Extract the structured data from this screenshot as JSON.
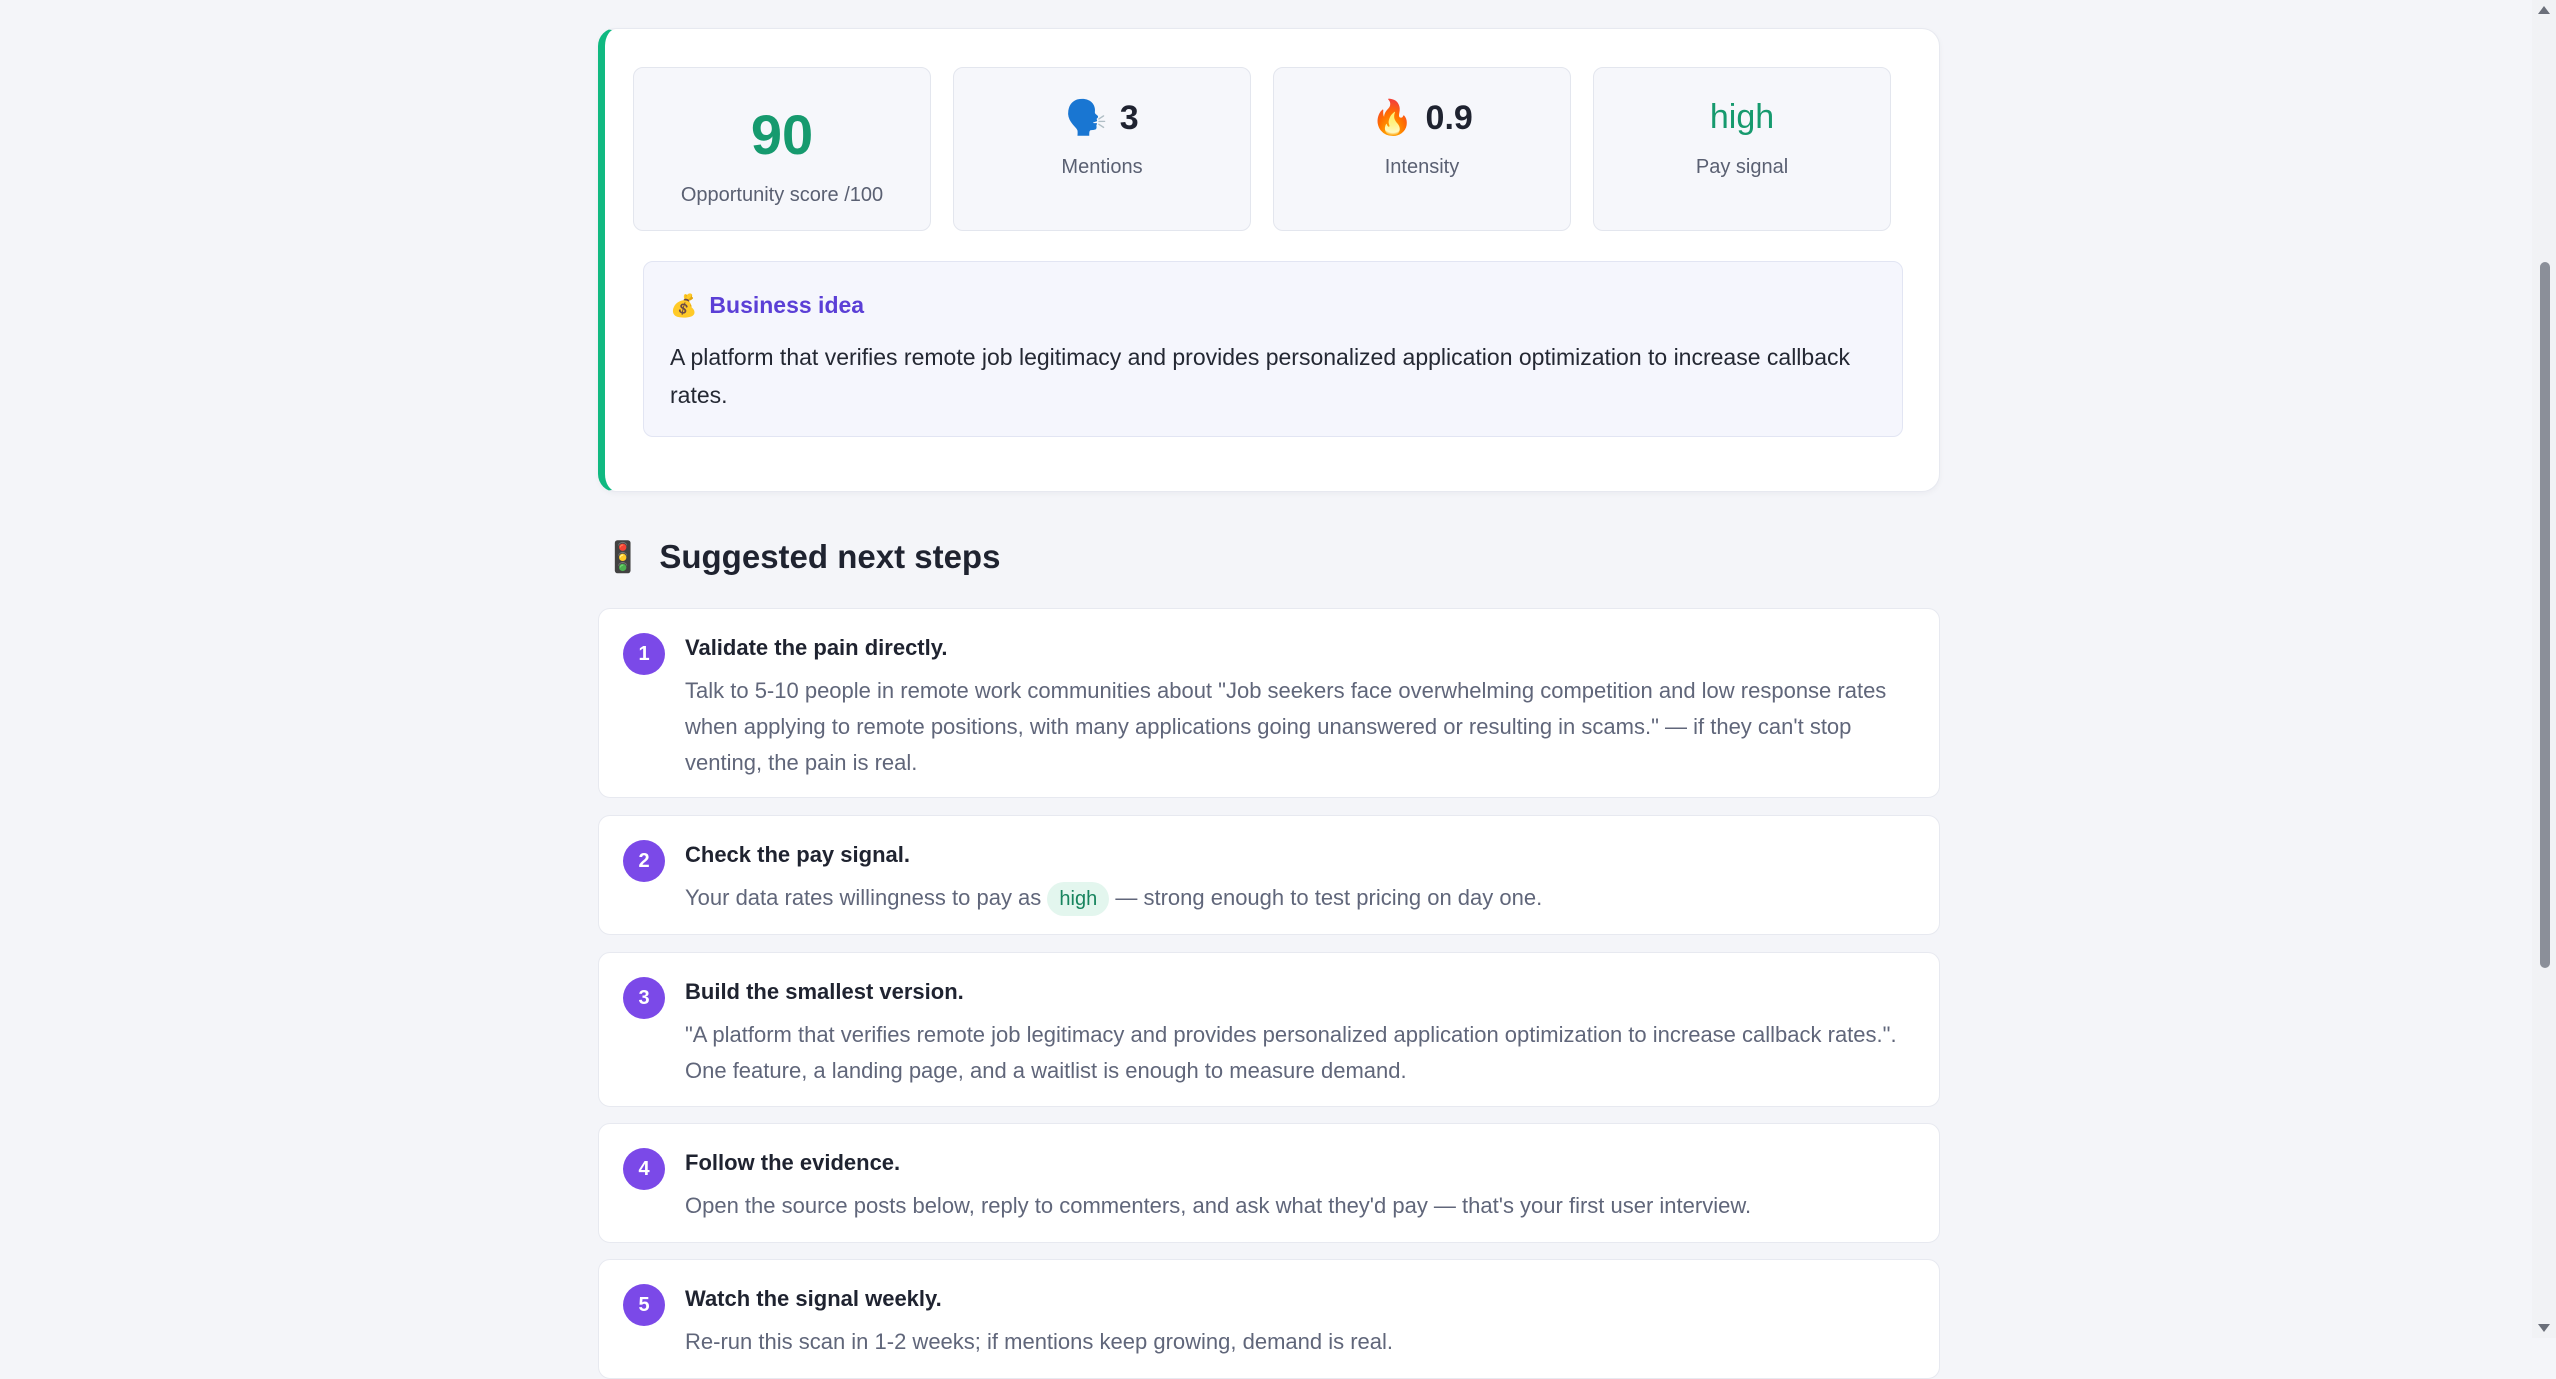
{
  "stats": {
    "score": {
      "value": "90",
      "label": "Opportunity score /100"
    },
    "mentions": {
      "icon": "speaking-head-icon",
      "glyph": "🗣️",
      "value": "3",
      "label": "Mentions"
    },
    "intensity": {
      "icon": "fire-icon",
      "glyph": "🔥",
      "value": "0.9",
      "label": "Intensity"
    },
    "pay": {
      "value": "high",
      "label": "Pay signal"
    }
  },
  "idea": {
    "icon": "money-bag-icon",
    "glyph": "💰",
    "title": "Business idea",
    "text": "A platform that verifies remote job legitimacy and provides personalized application optimization to increase callback rates."
  },
  "next_steps": {
    "icon": "traffic-light-icon",
    "glyph": "🚦",
    "title": "Suggested next steps",
    "steps": [
      {
        "num": "1",
        "title": "Validate the pain directly.",
        "body": "Talk to 5-10 people in remote work communities about \"Job seekers face overwhelming competition and low response rates when applying to remote positions, with many applications going unanswered or resulting in scams.\" — if they can't stop venting, the pain is real."
      },
      {
        "num": "2",
        "title": "Check the pay signal.",
        "body_prefix": "Your data rates willingness to pay as",
        "badge": "high",
        "body_suffix": "— strong enough to test pricing on day one."
      },
      {
        "num": "3",
        "title": "Build the smallest version.",
        "body": "\"A platform that verifies remote job legitimacy and provides personalized application optimization to increase callback rates.\". One feature, a landing page, and a waitlist is enough to measure demand."
      },
      {
        "num": "4",
        "title": "Follow the evidence.",
        "body": "Open the source posts below, reply to commenters, and ask what they'd pay — that's your first user interview."
      },
      {
        "num": "5",
        "title": "Watch the signal weekly.",
        "body": "Re-run this scan in 1-2 weeks; if mentions keep growing, demand is real."
      }
    ]
  },
  "colors": {
    "accent_green": "#10b981",
    "score_green": "#169a6e",
    "idea_purple": "#5b3fd6",
    "step_purple": "#7b49e8"
  }
}
